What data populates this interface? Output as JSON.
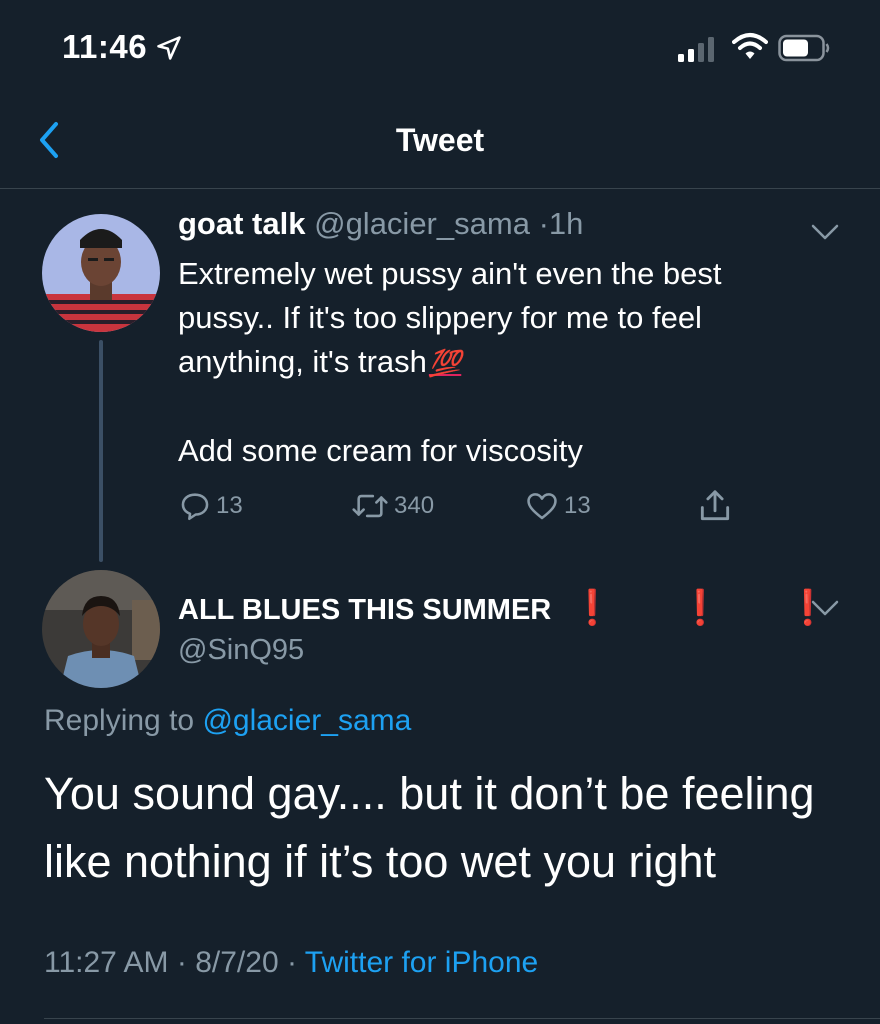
{
  "status_bar": {
    "time": "11:46",
    "icons": [
      "location-arrow-icon",
      "cellular-signal-icon",
      "wifi-icon",
      "battery-icon"
    ]
  },
  "nav": {
    "title": "Tweet",
    "back_icon": "chevron-left-icon"
  },
  "colors": {
    "background": "#15202b",
    "divider": "#38444d",
    "muted_text": "#8899a6",
    "link": "#1da1f2",
    "accent_red": "#e0245e"
  },
  "parent_tweet": {
    "display_name": "goat talk",
    "handle": "@glacier_sama",
    "separator": "·",
    "time_ago": "1h",
    "text_line1": "Extremely wet pussy ain't even the best pussy.. If it's too slippery for me to feel anything, it's trash",
    "emoji": "💯",
    "text_line2": "Add some cream for viscosity",
    "reply_count": "13",
    "retweet_count": "340",
    "like_count": "13"
  },
  "reply_tweet": {
    "display_name": "ALL BLUES THIS SUMMER",
    "name_emoji": "❗ ❗ ❗",
    "handle": "@SinQ95",
    "replying_prefix": "Replying to",
    "replying_handle": "@glacier_sama",
    "text": "You sound gay.... but it don’t be feeling like nothing if it’s too wet you right",
    "time": "11:27 AM",
    "date": "8/7/20",
    "separator": "·",
    "source": "Twitter for iPhone"
  }
}
